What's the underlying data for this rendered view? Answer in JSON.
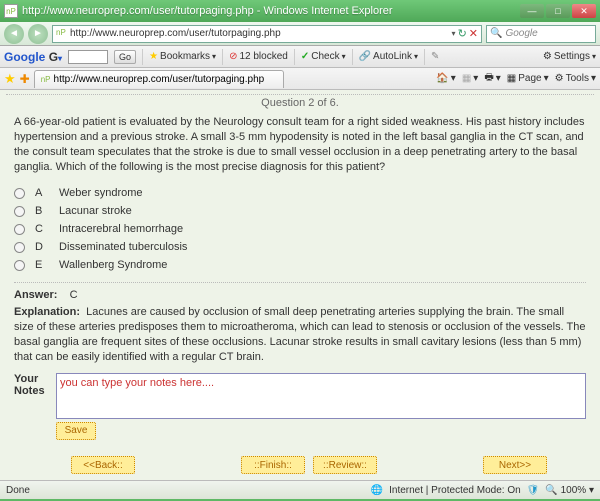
{
  "window": {
    "title": "http://www.neuroprep.com/user/tutorpaging.php - Windows Internet Explorer"
  },
  "address": {
    "url": "http://www.neuroprep.com/user/tutorpaging.php"
  },
  "search": {
    "placeholder": "Google"
  },
  "googlebar": {
    "brand": "Google",
    "brandSuffix": "G",
    "go": "Go",
    "bookmarks": "Bookmarks",
    "blocked": "12 blocked",
    "check": "Check",
    "autolink": "AutoLink",
    "settings": "Settings"
  },
  "tab": {
    "label": "http://www.neuroprep.com/user/tutorpaging.php"
  },
  "ietools": {
    "page": "Page",
    "tools": "Tools"
  },
  "quiz": {
    "counter": "Question 2 of 6.",
    "question": "A 66-year-old patient is evaluated by the Neurology consult team for a right sided weakness. His past history includes hypertension and a previous stroke. A small 3-5 mm hypodensity is noted in the left basal ganglia in the CT scan, and the consult team speculates that the stroke is due to small vessel occlusion in a deep penetrating artery to the basal ganglia. Which of the following is the most precise diagnosis for this patient?",
    "options": [
      {
        "letter": "A",
        "text": "Weber syndrome"
      },
      {
        "letter": "B",
        "text": "Lacunar stroke"
      },
      {
        "letter": "C",
        "text": "Intracerebral hemorrhage"
      },
      {
        "letter": "D",
        "text": "Disseminated tuberculosis"
      },
      {
        "letter": "E",
        "text": "Wallenberg Syndrome"
      }
    ],
    "answerLabel": "Answer:",
    "answerValue": "C",
    "explanationLabel": "Explanation:",
    "explanationText": "Lacunes are caused by occlusion of small deep penetrating arteries supplying the brain. The small size of these arteries predisposes them to microatheroma, which can lead to stenosis or occlusion of the vessels. The basal ganglia are frequent sites of these occlusions. Lacunar stroke results in small cavitary lesions (less than 5 mm) that can be easily identified with a regular CT brain.",
    "notesLabel": "Your Notes",
    "notesValue": "you can type your notes here....",
    "save": "Save",
    "back": "<<Back::",
    "finish": "::Finish::",
    "review": "::Review::",
    "next": "Next>>"
  },
  "status": {
    "done": "Done",
    "zone": "Internet | Protected Mode: On",
    "zoom": "100%"
  }
}
